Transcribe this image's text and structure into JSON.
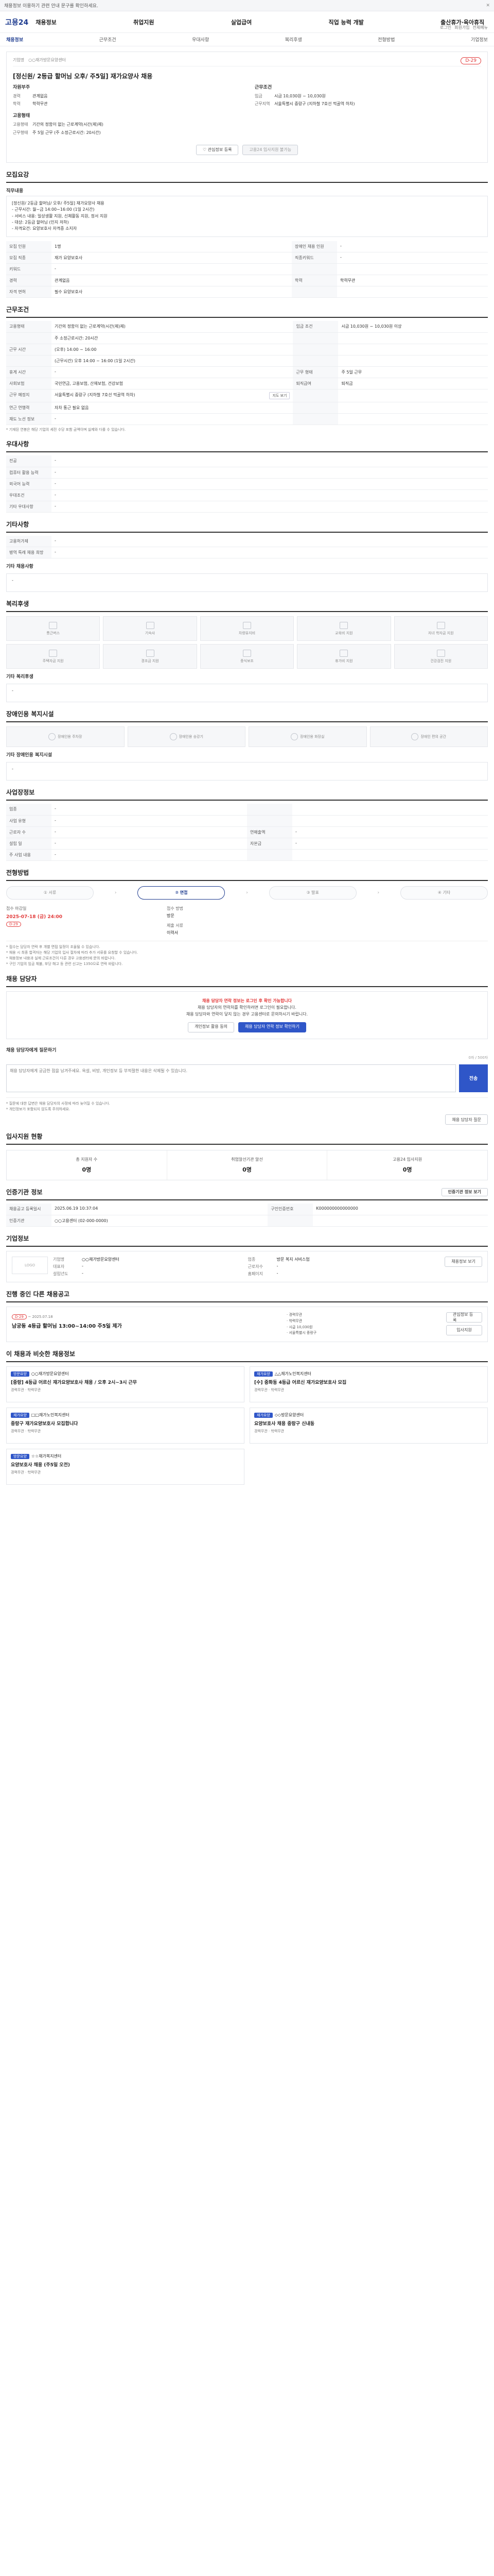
{
  "notice": {
    "text": "채용정보 이용하기 관련 안내 문구를 확인하세요.",
    "close": "✕"
  },
  "header": {
    "logo": "고용24",
    "gnb": [
      "채용정보",
      "취업지원",
      "실업급여",
      "직업 능력 개발",
      "출산휴가·육아휴직"
    ],
    "util": [
      "로그인",
      "회원가입",
      "전체메뉴"
    ]
  },
  "tabs": [
    "채용정보",
    "근무조건",
    "우대사항",
    "복리후생",
    "전형방법",
    "기업정보"
  ],
  "job": {
    "title": "[정신원/ 2등급 할머님 오후/ 주5일] 재가요양사 채용",
    "dday": "D-29",
    "company_label": "기업명",
    "company": "○○재가방문요양센터",
    "left_head": "자원부주",
    "left": [
      {
        "k": "경력",
        "v": "관계없음"
      },
      {
        "k": "학력",
        "v": "학력무관"
      }
    ],
    "left2_head": "고용형태",
    "left2": [
      {
        "k": "고용형태",
        "v": "기간의 정함이 없는 근로계약(시간(제)제)"
      },
      {
        "k": "근무형태",
        "v": "주 5일 근무 (주 소정근로시간: 20시간)"
      }
    ],
    "right_head": "근무조건",
    "right": [
      {
        "k": "임금",
        "v": "시급 10,030원 ~ 10,030원"
      },
      {
        "k": "근무지역",
        "v": "서울특별시 중랑구 (지하철 7호선 먹골역 하차)"
      }
    ],
    "btn_scrap": "관심정보 등록",
    "btn_apply": "고용24 입사지원 불가능"
  },
  "recruit": {
    "title": "모집요강",
    "desc_label": "직무내용",
    "desc": [
      "[정신원/ 2등급 할머님/ 오후/ 주5일] 재가요양사 채용",
      "- 근무시간: 월~금 14:00~16:00 (1일 2시간)",
      "- 서비스 내용: 일상생활 지원, 신체활동 지원, 정서 지원",
      "- 대상: 2등급 할머님 (인지 저하)",
      "- 자격요건: 요양보호사 자격증 소지자"
    ],
    "rows": [
      [
        "모집 인원",
        "1명",
        "장애인 채용 인원",
        "-"
      ],
      [
        "모집 직종",
        "재가 요양보호사",
        "직종키워드",
        "-"
      ],
      [
        "키워드",
        "-",
        "",
        ""
      ],
      [
        "경력",
        "관계없음",
        "학력",
        "학력무관"
      ],
      [
        "자격 면허",
        "필수  요양보호사",
        "",
        ""
      ]
    ]
  },
  "conditions": {
    "title": "근무조건",
    "rows": [
      [
        "고용형태",
        "기간의 정함이 없는 근로계약(시간(제)제)",
        "임금 조건",
        "시급 10,030원 ~ 10,030원 이상"
      ],
      [
        "",
        "주 소정근로시간: 20시간",
        "",
        ""
      ],
      [
        "근무 시간",
        "(오후) 14:00 ~ 16:00",
        "",
        ""
      ],
      [
        "",
        "(근무시간) 오후 14:00 ~ 16:00 (1일 2시간)",
        "",
        ""
      ],
      [
        "휴게 시간",
        "-",
        "근무 형태",
        "주 5일 근무"
      ],
      [
        "사회보험",
        "국민연금, 고용보험, 산재보험, 건강보험",
        "퇴직급여",
        "퇴직금"
      ],
      [
        "근무 예정지",
        "서울특별시 중랑구 (지하철 7호선 먹골역 하차)",
        "",
        ""
      ],
      [
        "연근 연행력",
        "자차 통근 필요 없음",
        "",
        ""
      ],
      [
        "재도 노선 정보",
        "-",
        "",
        ""
      ]
    ],
    "map_btn": "지도 보기",
    "note": "* 기재된 연봉은 해당 기업의 세전 수당 포함 금액이며 실제와 다를 수 있습니다."
  },
  "preferences": {
    "title": "우대사항",
    "rows": [
      [
        "전공",
        "-"
      ],
      [
        "컴퓨터 활용 능력",
        "-"
      ],
      [
        "외국어 능력",
        "-"
      ],
      [
        "우대조건",
        "-"
      ],
      [
        "기타 우대사항",
        "-"
      ]
    ]
  },
  "other": {
    "title": "기타사항",
    "rows": [
      [
        "고용허가제",
        "-"
      ],
      [
        "병역 특례 채용 희망",
        "-"
      ]
    ],
    "etc_label": "기타 채용사항",
    "etc": "-"
  },
  "welfare": {
    "title": "복리후생",
    "items": [
      "통근버스",
      "기숙사",
      "차량유지비",
      "교육비 지원",
      "자녀 학자금 지원",
      "주택자금 지원",
      "경조금 지원",
      "중식보조",
      "휴가비 지원",
      "건강검진 지원"
    ],
    "etc_label": "기타 복리후생",
    "etc": "-"
  },
  "disability": {
    "title": "장애인용 복지시설",
    "items": [
      "장애인용 주차장",
      "장애인용 승강기",
      "장애인용 화장실",
      "장애인 편의 공간"
    ],
    "etc_label": "기타 장애인용 복지시설",
    "etc": "-"
  },
  "workplace": {
    "title": "사업장정보",
    "rows": [
      [
        "업종",
        "-",
        "",
        ""
      ],
      [
        "사업 유형",
        "-",
        "",
        ""
      ],
      [
        "근로자 수",
        "-",
        "연매출액",
        "-"
      ],
      [
        "설립 일",
        "-",
        "자본금",
        "-"
      ],
      [
        "주 사업 내용",
        "-",
        "",
        ""
      ]
    ]
  },
  "selection": {
    "title": "전형방법",
    "steps": [
      "① 서류",
      "② 면접",
      "③ 발표",
      "④ 기타"
    ],
    "active": 1,
    "deadline_label": "접수 마감일",
    "deadline": "2025-07-18 (금) 24:00",
    "dday": "D-29",
    "method_label": "접수 방법",
    "method": "방문",
    "docs_label": "제출 서류",
    "docs": "이력서",
    "notes": [
      "* 접수는 담당자 연락 후 개별 면접 일정이 조율될 수 있습니다.",
      "* 채용 시 최종 합격자는 해당 기업의 입사 절차에 따라 추가 서류를 요청할 수 있습니다.",
      "* 채용정보 내용과 실제 근로조건이 다른 경우 고용센터에 문의 바랍니다.",
      "* 구인 기업의 임금 체불, 부당 해고 등 관련 신고는 1350으로 연락 바랍니다."
    ]
  },
  "contact": {
    "title": "채용 담당자",
    "lines": [
      "채용 담당자의 연락처를 확인하려면 로그인이 필요합니다.",
      "채용 담당자와 연락이 닿지 않는 경우 고용센터로 문의하시기 바랍니다."
    ],
    "highlight": "채용 담당자 연락 정보는 로그인 후 확인 가능합니다",
    "btn1": "개인정보 활용 동의",
    "btn2": "채용 담당자 연락 정보 확인하기"
  },
  "inquiry": {
    "title": "채용 담당자에게 질문하기",
    "count": "0자 / 500자",
    "placeholder": "채용 담당자에게 궁금한 점을 남겨주세요. 욕설, 비방, 개인정보 등 부적절한 내용은 삭제될 수 있습니다.",
    "send": "전송",
    "notes": [
      "* 질문에 대한 답변은 채용 담당자의 사정에 따라 늦어질 수 있습니다.",
      "* 개인정보가 포함되지 않도록 주의하세요."
    ],
    "ask_btn": "채용 담당자 질문"
  },
  "status": {
    "title": "입사지원 현황",
    "items": [
      {
        "label": "총 지원자 수",
        "value": "0명"
      },
      {
        "label": "취업알선기관 알선",
        "value": "0명"
      },
      {
        "label": "고용24 입사지원",
        "value": "0명"
      }
    ]
  },
  "hire_info": {
    "title": "인증기관 정보",
    "btn": "인증기관 정보 보기",
    "rows": [
      [
        "채용공고 등록일시",
        "2025.06.19 10:37:04",
        "구인인증번호",
        "K000000000000000"
      ],
      [
        "인증기관",
        "○○고용센터 (02-000-0000)",
        "",
        ""
      ]
    ]
  },
  "company_info": {
    "title": "기업정보",
    "logo": "LOGO",
    "rows": [
      [
        "기업명",
        "○○재가방문요양센터"
      ],
      [
        "업종",
        "방문 복지 서비스업"
      ],
      [
        "대표자",
        "-"
      ],
      [
        "근로자수",
        "-"
      ],
      [
        "설립년도",
        "-"
      ],
      [
        "홈페이지",
        "-"
      ]
    ],
    "btn": "채용정보 보기"
  },
  "ongoing": {
    "title": "진행 중인 다른 채용공고",
    "dday": "D-29",
    "date": "~ 2025.07.18",
    "post_title": "남궁동 4등급 할머님 13:00~14:00 주5일 제가",
    "meta": [
      "경력무관",
      "학력무관",
      "시급 10,030원",
      "서울특별시 중랑구"
    ],
    "btn1": "관심정보 등록",
    "btn2": "입사지원"
  },
  "recommend": {
    "title": "이 채용과 비슷한 채용정보",
    "cards": [
      {
        "badge": "방문요양",
        "company": "○○재가방문요양센터",
        "title": "[중랑] 4등급 어르신 재가요양보호사 채용 / 오후 2시~3시 근무",
        "meta": "경력무관 · 학력무관"
      },
      {
        "badge": "재가요양",
        "company": "△△재가노인복지센터",
        "title": "[수] 중화동 4등급 어르신 재가요양보호사 모집",
        "meta": "경력무관 · 학력무관"
      },
      {
        "badge": "재가요양",
        "company": "□□재가노인복지센터",
        "title": "중랑구 재가요양보호사 모집합니다",
        "meta": "경력무관 · 학력무관"
      },
      {
        "badge": "재가요양",
        "company": "◇◇방문요양센터",
        "title": "요양보호사 채용 중랑구 신내동",
        "meta": "경력무관 · 학력무관"
      },
      {
        "badge": "방문요양",
        "company": "☆☆재가복지센터",
        "title": "요양보호사 채용 (주5일 오전)",
        "meta": "경력무관 · 학력무관"
      }
    ]
  }
}
